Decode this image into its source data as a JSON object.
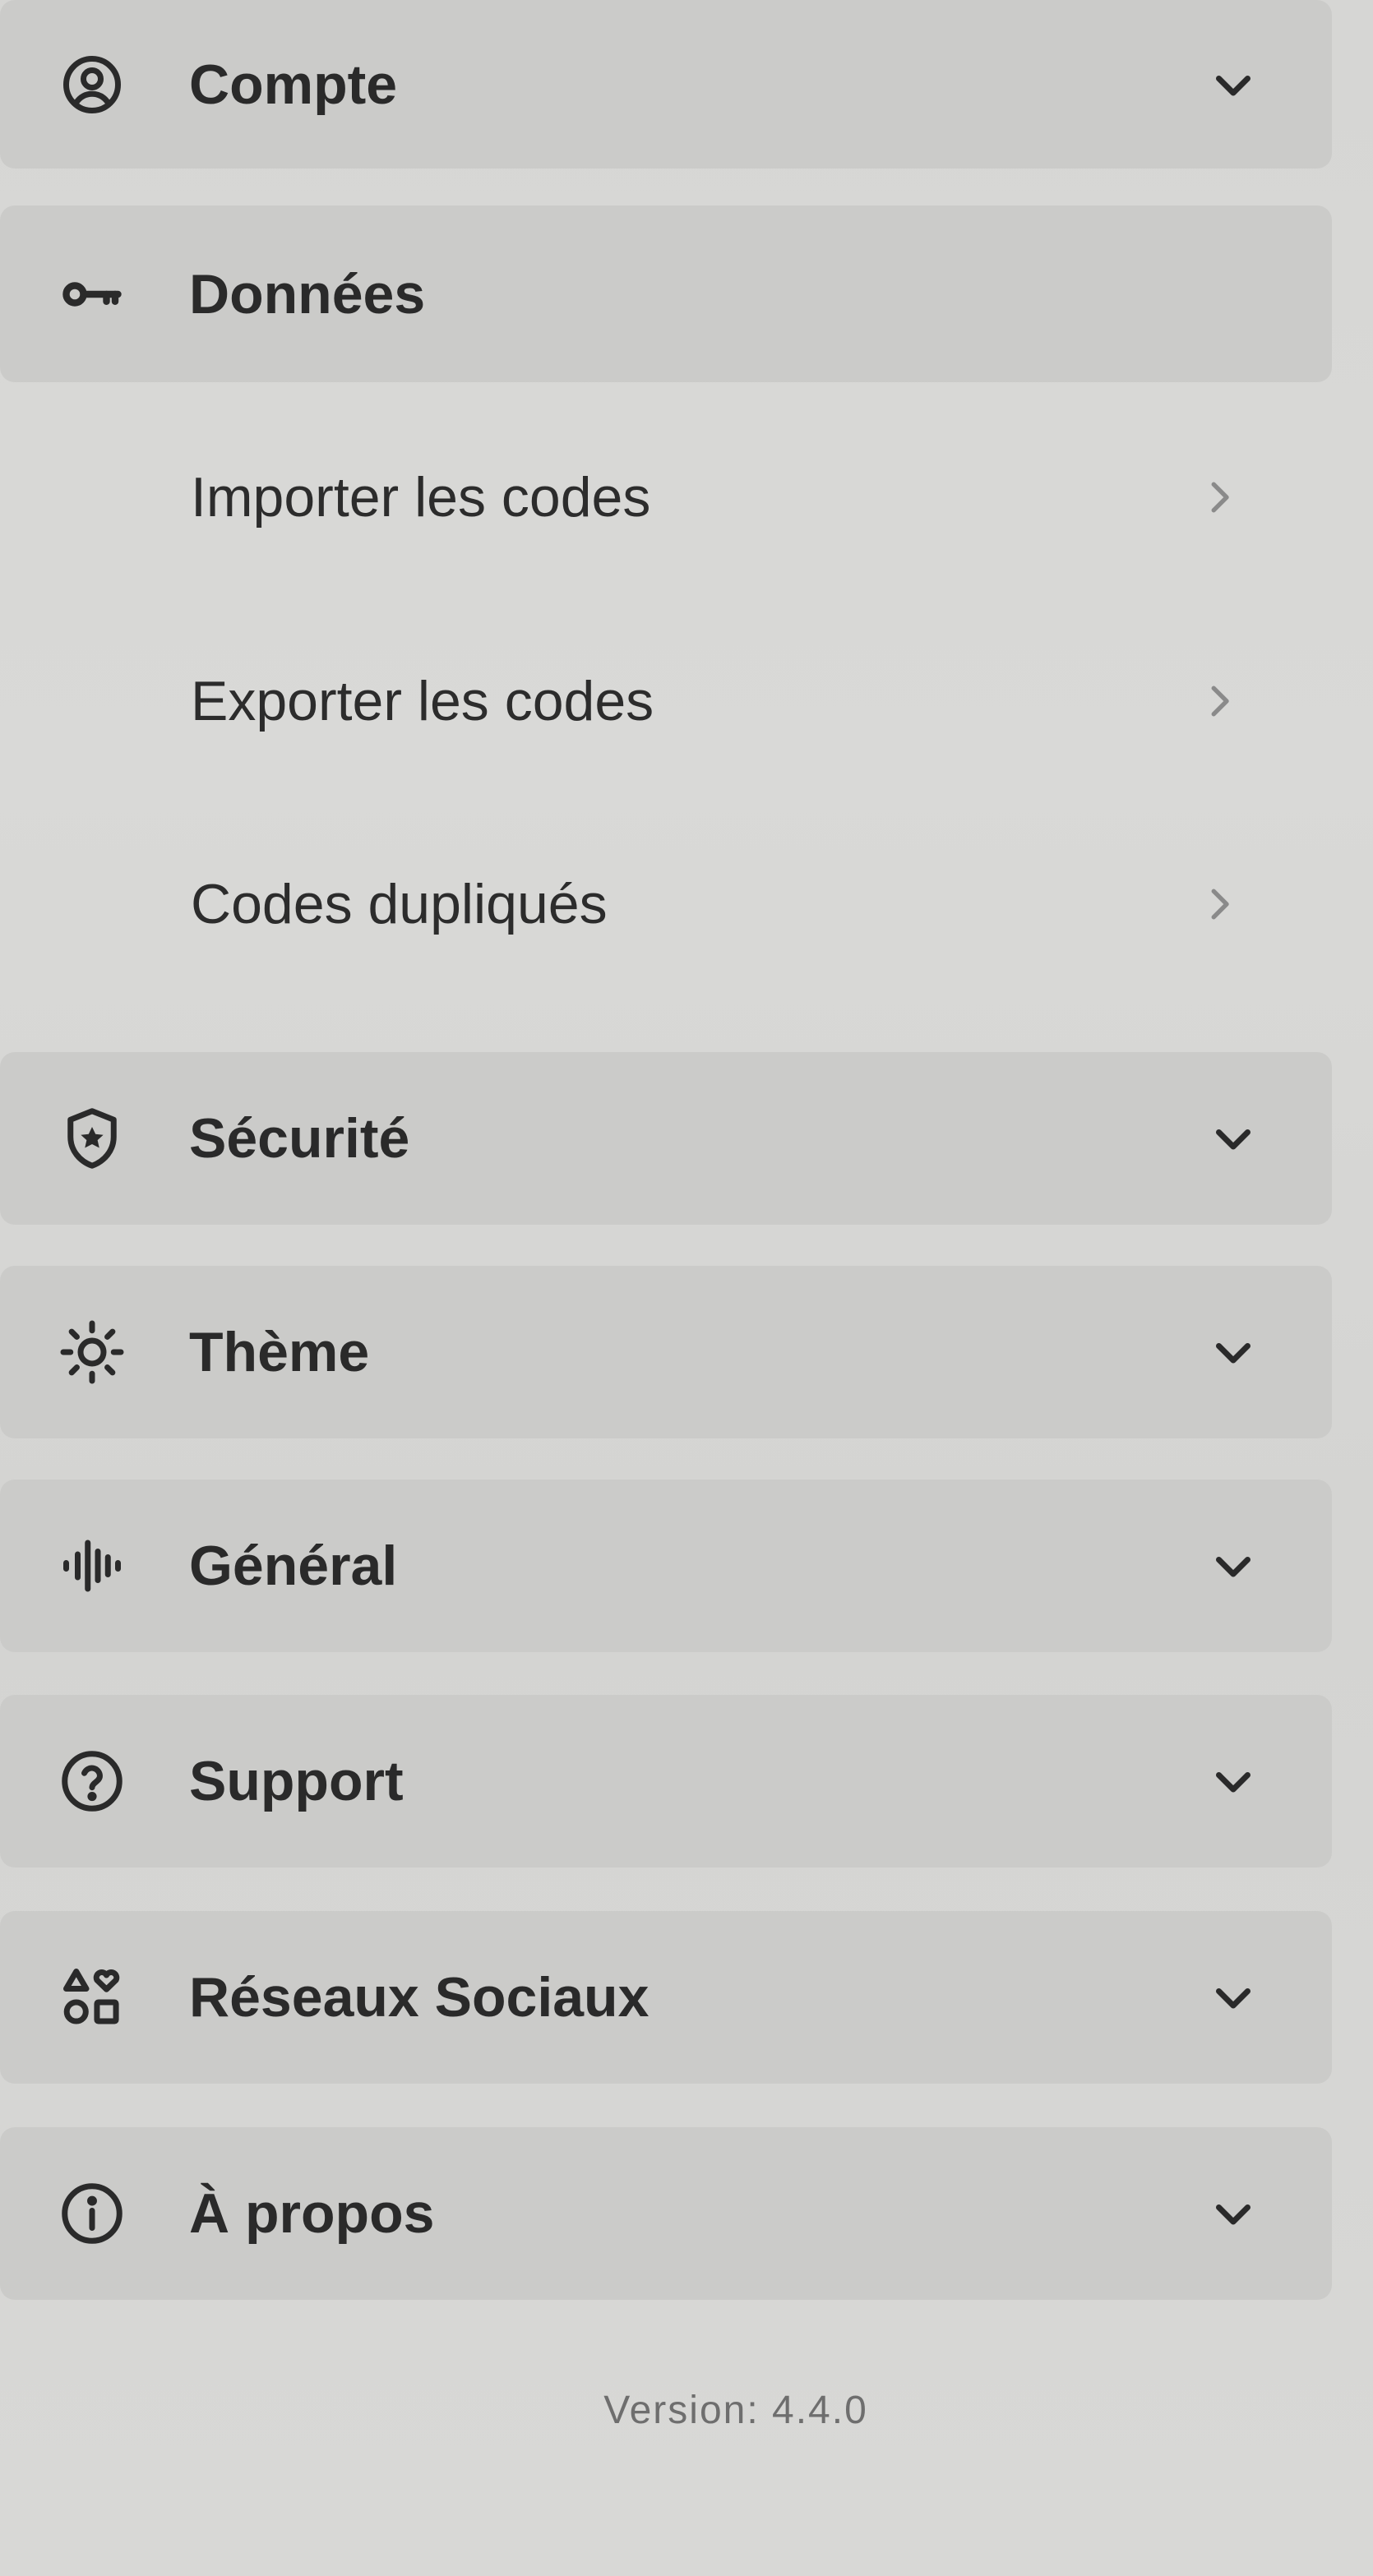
{
  "menu": {
    "sections": [
      {
        "label": "Compte",
        "icon": "account-circle-icon",
        "state": "collapsed"
      },
      {
        "label": "Données",
        "icon": "key-icon",
        "state": "expanded",
        "subitems": [
          {
            "label": "Importer les codes"
          },
          {
            "label": "Exporter les codes"
          },
          {
            "label": "Codes dupliqués"
          }
        ]
      },
      {
        "label": "Sécurité",
        "icon": "shield-star-icon",
        "state": "collapsed"
      },
      {
        "label": "Thème",
        "icon": "sun-icon",
        "state": "collapsed"
      },
      {
        "label": "Général",
        "icon": "waveform-icon",
        "state": "collapsed"
      },
      {
        "label": "Support",
        "icon": "help-circle-icon",
        "state": "collapsed"
      },
      {
        "label": "Réseaux Sociaux",
        "icon": "shapes-icon",
        "state": "collapsed"
      },
      {
        "label": "À propos",
        "icon": "info-circle-icon",
        "state": "collapsed"
      }
    ]
  },
  "footer": {
    "version": "Version: 4.4.0"
  },
  "colors": {
    "background": "#d7d7d5",
    "section_background": "#cbcbc9",
    "text": "#242424",
    "muted_text": "#6e6e6e"
  }
}
